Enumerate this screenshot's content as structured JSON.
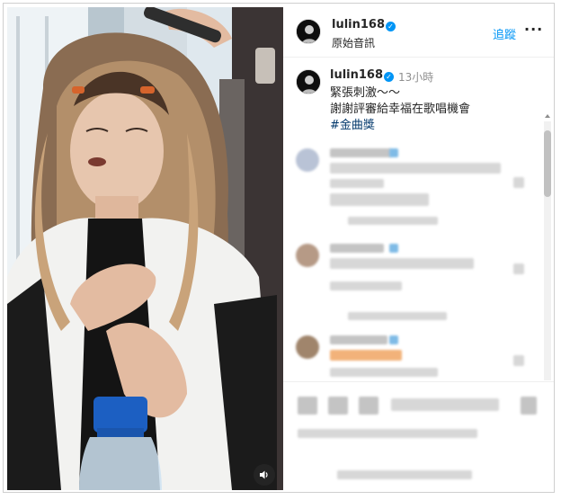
{
  "post": {
    "username": "lulin168",
    "audio_label": "原始音訊",
    "follow_label": "追蹤",
    "more_label": "···",
    "verified_mark": "✓"
  },
  "caption": {
    "username": "lulin168",
    "time": "13小時",
    "line1": "緊張刺激～～",
    "line2": "謝謝評審給幸福在歌唱機會",
    "hashtag": "#金曲獎"
  },
  "icons": {
    "sound": "speaker-icon",
    "verified": "verified-badge-icon",
    "more": "more-options-icon"
  },
  "colors": {
    "accent": "#0095f6",
    "hashtag": "#00376b",
    "muted": "#8e8e8e"
  }
}
